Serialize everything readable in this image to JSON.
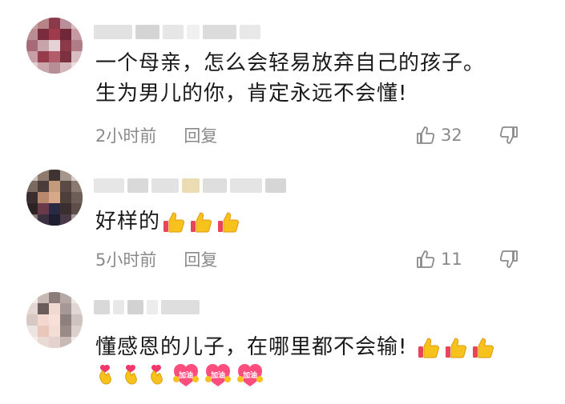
{
  "comments": [
    {
      "text_lines": [
        "一个母亲，怎么会轻易放弃自己的孩子。",
        "生为男儿的你，肯定永远不会懂!"
      ],
      "time": "2小时前",
      "reply_label": "回复",
      "likes": "32",
      "emojis": []
    },
    {
      "text_lines": [
        "好样的"
      ],
      "time": "5小时前",
      "reply_label": "回复",
      "likes": "11",
      "emojis": [
        "thumbs-up",
        "thumbs-up",
        "thumbs-up"
      ]
    },
    {
      "text_lines": [
        "懂感恩的儿子，在哪里都不会输!"
      ],
      "emojis": [
        "thumbs-up",
        "thumbs-up",
        "thumbs-up"
      ],
      "emojis_line2": [
        "finger-heart",
        "finger-heart",
        "finger-heart",
        "jiayou-heart",
        "jiayou-heart",
        "jiayou-heart"
      ],
      "jiayou_label": "加油"
    }
  ],
  "icons": {
    "like": "thumbs-up-outline-icon",
    "dislike": "thumbs-down-outline-icon"
  },
  "colors": {
    "text": "#1a1a1a",
    "meta": "#8a8a8a",
    "background": "#ffffff"
  }
}
